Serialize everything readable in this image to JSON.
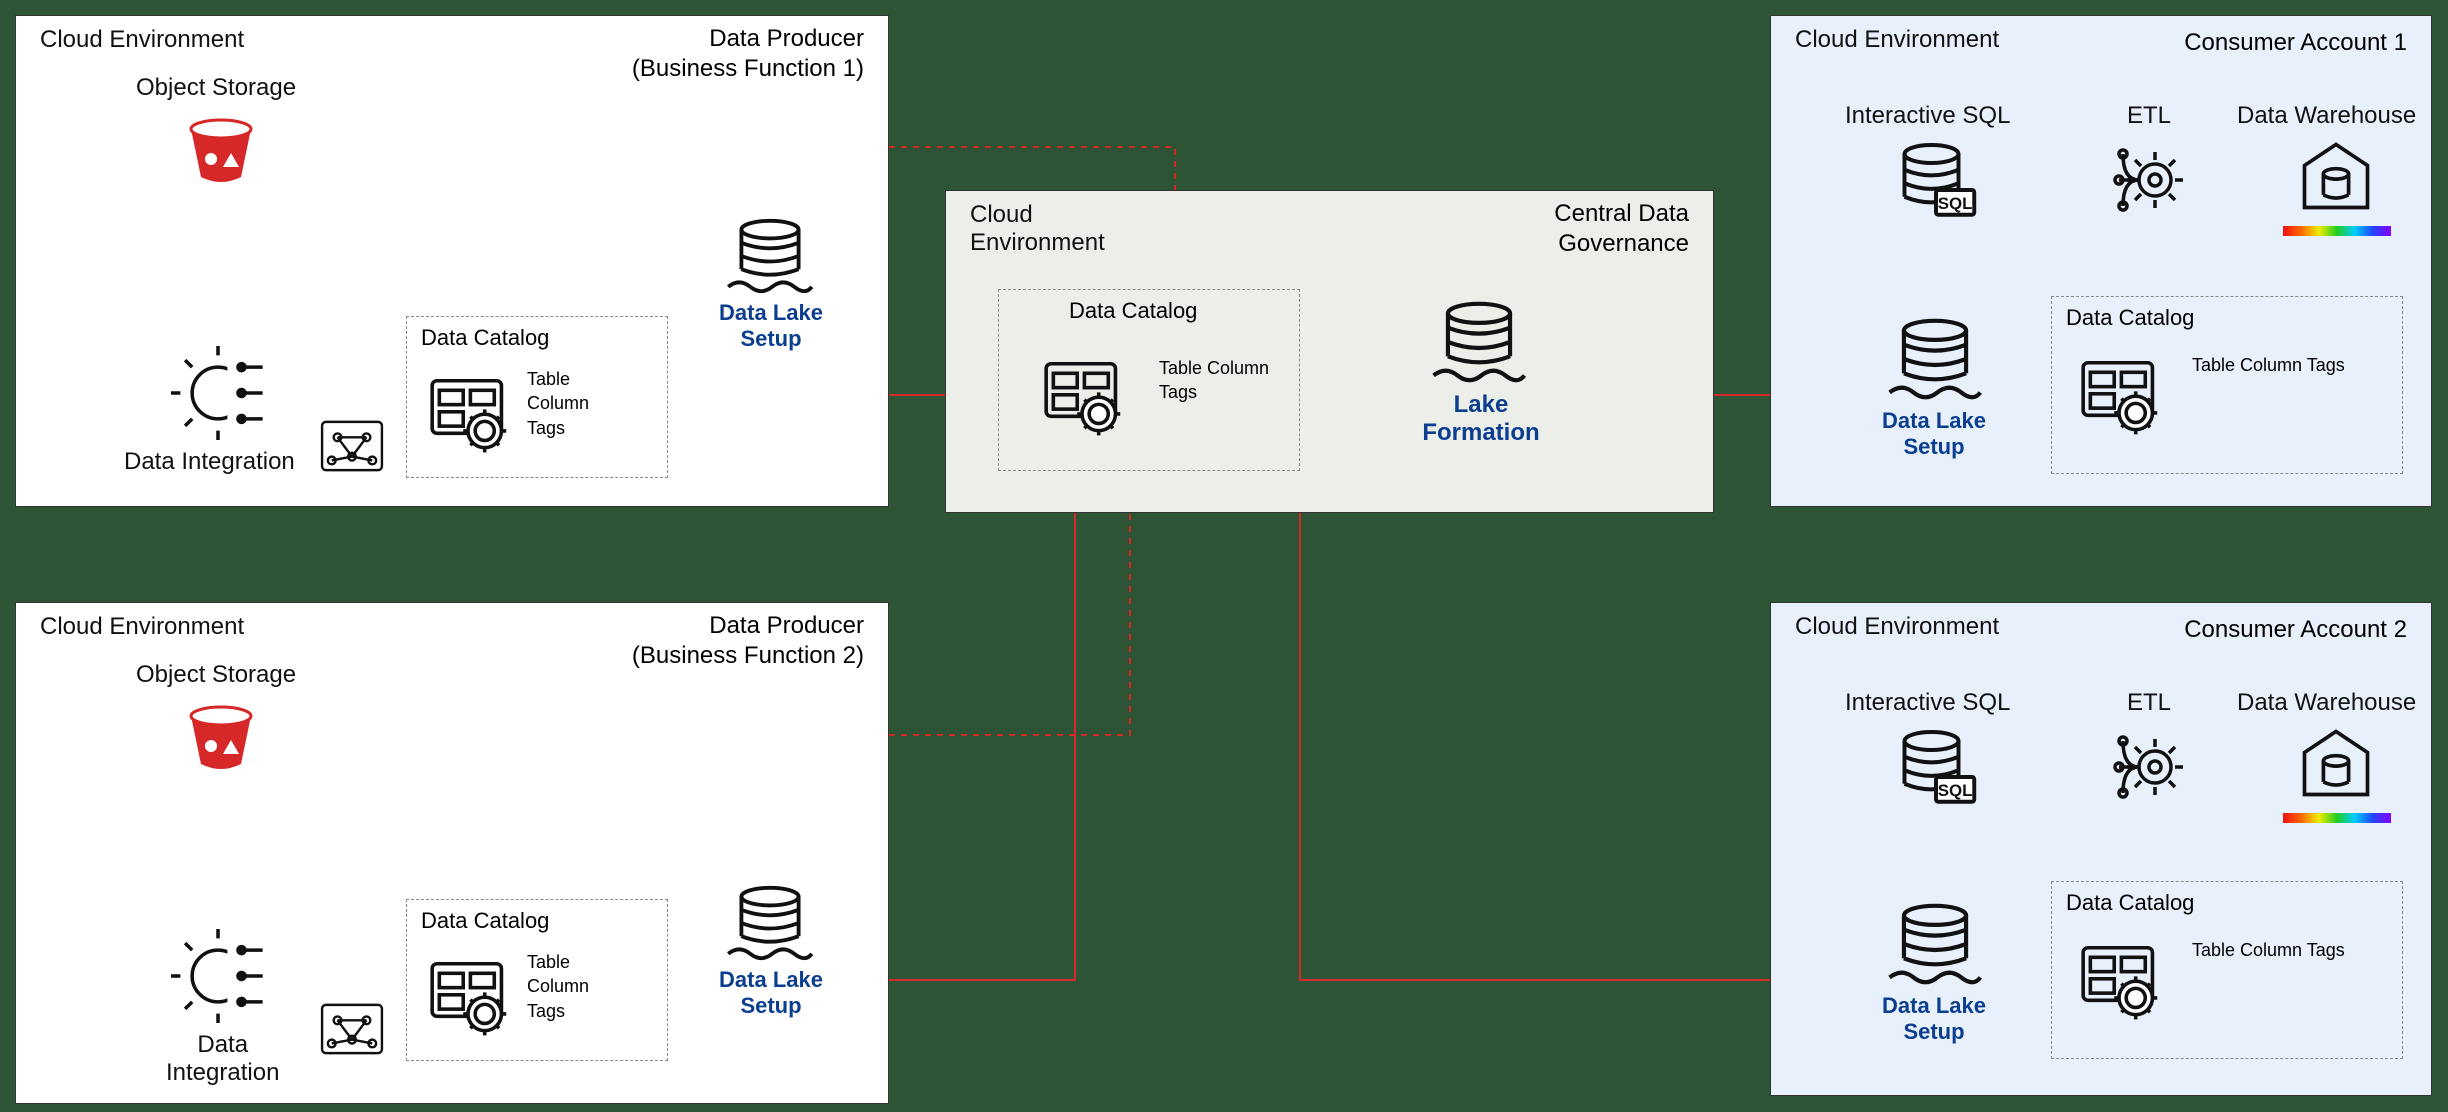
{
  "producer1": {
    "envHeader": "Cloud Environment",
    "title": "Data Producer\n(Business Function 1)",
    "storageLabel": "Object Storage",
    "integrationLabel": "Data Integration",
    "lakeLabel": "Data Lake\nSetup",
    "catalog": {
      "title": "Data Catalog",
      "items": "Table\nColumn\nTags"
    }
  },
  "producer2": {
    "envHeader": "Cloud Environment",
    "title": "Data Producer\n(Business Function 2)",
    "storageLabel": "Object Storage",
    "integrationLabel": "Data\nIntegration",
    "lakeLabel": "Data Lake\nSetup",
    "catalog": {
      "title": "Data Catalog",
      "items": "Table\nColumn\nTags"
    }
  },
  "central": {
    "envHeader": "Cloud\nEnvironment",
    "title": "Central Data\nGovernance",
    "lakeLabel": "Lake\nFormation",
    "catalog": {
      "title": "Data Catalog",
      "items": "Table\nColumn\nTags"
    }
  },
  "consumer1": {
    "envHeader": "Cloud Environment",
    "title": "Consumer Account 1",
    "sqlLabel": "Interactive SQL",
    "etlLabel": "ETL",
    "warehouseLabel": "Data Warehouse",
    "lakeLabel": "Data Lake\nSetup",
    "catalog": {
      "title": "Data Catalog",
      "items": "Table\nColumn\nTags"
    }
  },
  "consumer2": {
    "envHeader": "Cloud Environment",
    "title": "Consumer Account 2",
    "sqlLabel": "Interactive SQL",
    "etlLabel": "ETL",
    "warehouseLabel": "Data Warehouse",
    "lakeLabel": "Data Lake\nSetup",
    "catalog": {
      "title": "Data Catalog",
      "items": "Table\nColumn\nTags"
    }
  },
  "colors": {
    "accent": "#d62828",
    "link": "#0b3e8f"
  }
}
